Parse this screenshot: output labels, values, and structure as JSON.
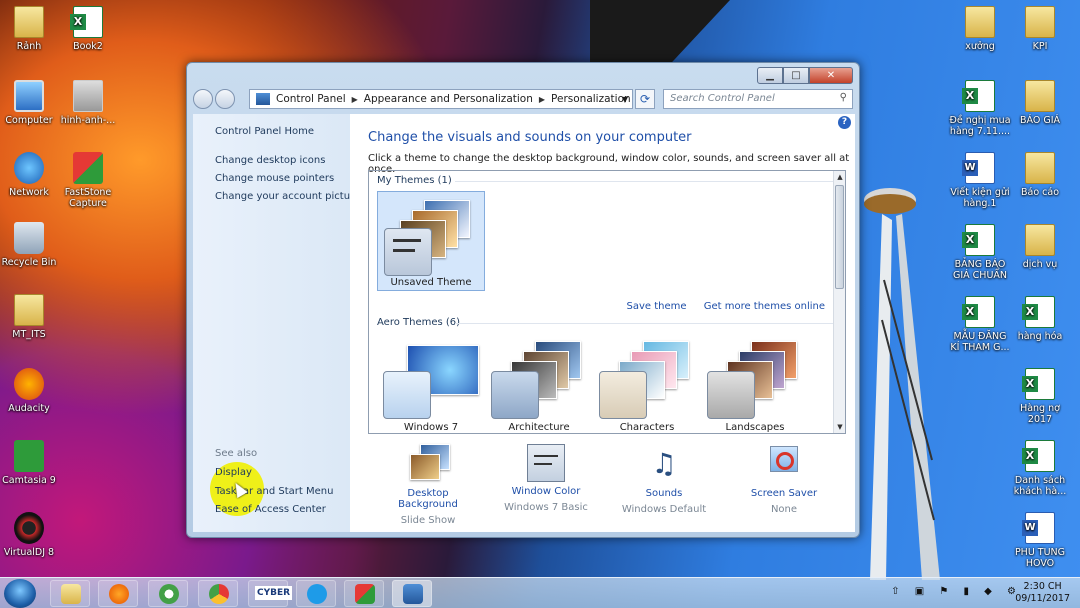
{
  "desktop": {
    "left_icons": [
      {
        "label": "Rảnh",
        "icon": "folder-icon"
      },
      {
        "label": "Book2",
        "icon": "excel-file-icon"
      },
      {
        "label": "Computer",
        "icon": "computer-icon"
      },
      {
        "label": "hinh-anh-...",
        "icon": "image-file-icon"
      },
      {
        "label": "Network",
        "icon": "network-icon"
      },
      {
        "label": "FastStone Capture",
        "icon": "faststone-capture-icon"
      },
      {
        "label": "Recycle Bin",
        "icon": "recycle-bin-icon"
      },
      {
        "label": "MT_ITS",
        "icon": "folder-icon"
      },
      {
        "label": "Audacity",
        "icon": "audacity-icon"
      },
      {
        "label": "Camtasia 9",
        "icon": "camtasia-icon"
      },
      {
        "label": "VirtualDJ 8",
        "icon": "virtualdj-icon"
      }
    ],
    "right_icons": [
      {
        "label": "xưởng",
        "icon": "folder-icon"
      },
      {
        "label": "KPI",
        "icon": "folder-icon"
      },
      {
        "label": "Đề nghị mua hàng 7.11....",
        "icon": "excel-file-icon"
      },
      {
        "label": "BÁO GIÁ",
        "icon": "folder-icon"
      },
      {
        "label": "Viết kiện gửi hàng.1",
        "icon": "word-file-icon"
      },
      {
        "label": "Báo cáo",
        "icon": "folder-icon"
      },
      {
        "label": "BẢNG BÁO GIÁ CHUẨN",
        "icon": "excel-file-icon"
      },
      {
        "label": "dịch vụ",
        "icon": "folder-icon"
      },
      {
        "label": "MẪU ĐĂNG KÍ THAM G...",
        "icon": "excel-file-icon"
      },
      {
        "label": "hàng hóa",
        "icon": "excel-file-icon"
      },
      {
        "label": "Hàng nợ 2017",
        "icon": "excel-file-icon"
      },
      {
        "label": "Danh sách khách hà...",
        "icon": "excel-file-icon"
      },
      {
        "label": "PHU TUNG HOVO",
        "icon": "word-file-icon"
      }
    ]
  },
  "window": {
    "address": [
      "Control Panel",
      "Appearance and Personalization",
      "Personalization"
    ],
    "search_placeholder": "Search Control Panel",
    "left": {
      "home": "Control Panel Home",
      "links": [
        "Change desktop icons",
        "Change mouse pointers",
        "Change your account picture"
      ],
      "see_also": "See also",
      "see_also_links": [
        "Display",
        "Taskbar and Start Menu",
        "Ease of Access Center"
      ]
    },
    "heading": "Change the visuals and sounds on your computer",
    "subtitle": "Click a theme to change the desktop background, window color, sounds, and screen saver all at once.",
    "my_themes_header": "My Themes (1)",
    "my_themes": [
      {
        "name": "Unsaved Theme"
      }
    ],
    "save_theme": "Save theme",
    "get_more": "Get more themes online",
    "aero_header": "Aero Themes (6)",
    "aero_themes": [
      {
        "name": "Windows 7"
      },
      {
        "name": "Architecture"
      },
      {
        "name": "Characters"
      },
      {
        "name": "Landscapes"
      }
    ],
    "bottom": [
      {
        "label": "Desktop Background",
        "value": "Slide Show",
        "icon": "desktop-background-icon"
      },
      {
        "label": "Window Color",
        "value": "Windows 7 Basic",
        "icon": "window-color-icon"
      },
      {
        "label": "Sounds",
        "value": "Windows Default",
        "icon": "sounds-icon"
      },
      {
        "label": "Screen Saver",
        "value": "None",
        "icon": "screen-saver-icon"
      }
    ]
  },
  "taskbar": {
    "cyber_label": "CYBER",
    "time": "2:30 CH",
    "date": "09/11/2017"
  }
}
